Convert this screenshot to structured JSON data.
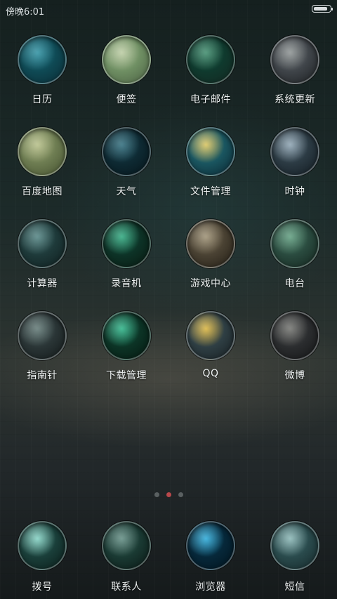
{
  "status": {
    "time": "傍晚6:01",
    "battery_level": 0.85
  },
  "apps": [
    {
      "label": "日历",
      "icon": "calendar-icon",
      "colors": [
        "#0f4a55",
        "#2a8fa0",
        "#0a2a33"
      ]
    },
    {
      "label": "便签",
      "icon": "notes-icon",
      "colors": [
        "#6f8f63",
        "#b9caa0",
        "#4a5f42"
      ]
    },
    {
      "label": "电子邮件",
      "icon": "email-icon",
      "colors": [
        "#0f3a2e",
        "#3b8a6a",
        "#142620"
      ]
    },
    {
      "label": "系统更新",
      "icon": "system-update-icon",
      "colors": [
        "#40454a",
        "#8a9090",
        "#1b1e20"
      ]
    },
    {
      "label": "百度地图",
      "icon": "map-icon",
      "colors": [
        "#6e7d52",
        "#b4bd85",
        "#44502f"
      ]
    },
    {
      "label": "天气",
      "icon": "weather-icon",
      "colors": [
        "#0e2a33",
        "#2c6a7a",
        "#061419"
      ]
    },
    {
      "label": "文件管理",
      "icon": "file-manager-icon",
      "colors": [
        "#1a5660",
        "#d8c25a",
        "#0a2530"
      ]
    },
    {
      "label": "时钟",
      "icon": "clock-icon",
      "colors": [
        "#2c3b44",
        "#8aa1b0",
        "#111a20"
      ]
    },
    {
      "label": "计算器",
      "icon": "calculator-icon",
      "colors": [
        "#1e3a3a",
        "#4f8180",
        "#0f1d1d"
      ]
    },
    {
      "label": "录音机",
      "icon": "recorder-icon",
      "colors": [
        "#0d3327",
        "#2aa77c",
        "#08170f"
      ]
    },
    {
      "label": "游戏中心",
      "icon": "game-center-icon",
      "colors": [
        "#4a4233",
        "#9a8d70",
        "#211c14"
      ]
    },
    {
      "label": "电台",
      "icon": "radio-icon",
      "colors": [
        "#2a4b3f",
        "#5c9b7c",
        "#13231d"
      ]
    },
    {
      "label": "指南针",
      "icon": "compass-icon",
      "colors": [
        "#2a3536",
        "#5d7572",
        "#121818"
      ]
    },
    {
      "label": "下载管理",
      "icon": "download-manager-icon",
      "colors": [
        "#0c3426",
        "#27b184",
        "#06160f"
      ]
    },
    {
      "label": "QQ",
      "icon": "qq-icon",
      "colors": [
        "#2f3f44",
        "#d8b23a",
        "#161d20"
      ]
    },
    {
      "label": "微博",
      "icon": "weibo-icon",
      "colors": [
        "#2b2d2f",
        "#6e6f6b",
        "#131415"
      ]
    }
  ],
  "page_indicator": {
    "count": 3,
    "active_index": 1,
    "active_color": "#b9484b"
  },
  "dock": [
    {
      "label": "拨号",
      "icon": "phone-icon",
      "colors": [
        "#1a3f3a",
        "#7fd0c1",
        "#0a1b18"
      ]
    },
    {
      "label": "联系人",
      "icon": "contacts-icon",
      "colors": [
        "#1a3a33",
        "#5e8a80",
        "#0a1714"
      ]
    },
    {
      "label": "浏览器",
      "icon": "browser-icon",
      "colors": [
        "#06283a",
        "#26a8d8",
        "#02121b"
      ]
    },
    {
      "label": "短信",
      "icon": "sms-icon",
      "colors": [
        "#2a4b4d",
        "#86b4b3",
        "#142628"
      ]
    }
  ]
}
